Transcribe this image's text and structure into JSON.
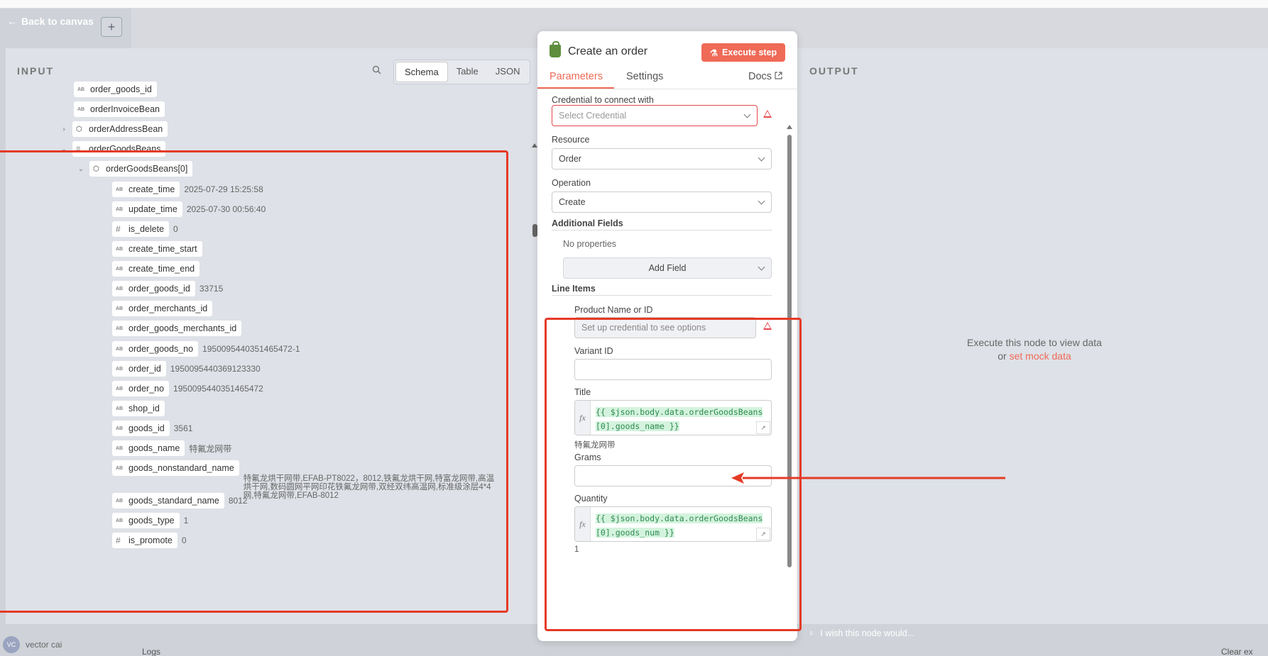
{
  "nav": {
    "back_label": "Back to canvas",
    "plus_label": "+"
  },
  "input_panel": {
    "title": "INPUT",
    "views": [
      "Schema",
      "Table",
      "JSON"
    ],
    "active_view": "Schema",
    "rows": [
      {
        "indent": 0,
        "caret": "",
        "type": "AB",
        "key": "order_goods_id",
        "value": ""
      },
      {
        "indent": 0,
        "caret": "",
        "type": "AB",
        "key": "orderInvoiceBean",
        "value": ""
      },
      {
        "indent": 0,
        "caret": "›",
        "type": "obj",
        "key": "orderAddressBean",
        "value": ""
      },
      {
        "indent": 0,
        "caret": "⌄",
        "type": "arr",
        "key": "orderGoodsBeans",
        "value": ""
      },
      {
        "indent": 1,
        "caret": "⌄",
        "type": "obj",
        "key": "orderGoodsBeans[0]",
        "value": ""
      },
      {
        "indent": 2,
        "caret": "",
        "type": "AB",
        "key": "create_time",
        "value": "2025-07-29 15:25:58"
      },
      {
        "indent": 2,
        "caret": "",
        "type": "AB",
        "key": "update_time",
        "value": "2025-07-30 00:56:40"
      },
      {
        "indent": 2,
        "caret": "",
        "type": "#",
        "key": "is_delete",
        "value": "0"
      },
      {
        "indent": 2,
        "caret": "",
        "type": "AB",
        "key": "create_time_start",
        "value": ""
      },
      {
        "indent": 2,
        "caret": "",
        "type": "AB",
        "key": "create_time_end",
        "value": ""
      },
      {
        "indent": 2,
        "caret": "",
        "type": "AB",
        "key": "order_goods_id",
        "value": "33715"
      },
      {
        "indent": 2,
        "caret": "",
        "type": "AB",
        "key": "order_merchants_id",
        "value": ""
      },
      {
        "indent": 2,
        "caret": "",
        "type": "AB",
        "key": "order_goods_merchants_id",
        "value": ""
      },
      {
        "indent": 2,
        "caret": "",
        "type": "AB",
        "key": "order_goods_no",
        "value": "1950095440351465472-1"
      },
      {
        "indent": 2,
        "caret": "",
        "type": "AB",
        "key": "order_id",
        "value": "1950095440369123330"
      },
      {
        "indent": 2,
        "caret": "",
        "type": "AB",
        "key": "order_no",
        "value": "1950095440351465472"
      },
      {
        "indent": 2,
        "caret": "",
        "type": "AB",
        "key": "shop_id",
        "value": ""
      },
      {
        "indent": 2,
        "caret": "",
        "type": "AB",
        "key": "goods_id",
        "value": "3561"
      },
      {
        "indent": 2,
        "caret": "",
        "type": "AB",
        "key": "goods_name",
        "value": "特氟龙网带"
      },
      {
        "indent": 2,
        "caret": "",
        "type": "AB",
        "key": "goods_nonstandard_name",
        "value": "特氟龙烘干网带,EFAB-PT8022，8012,铁氟龙烘干网,特富龙网带,高温烘干网,数码圆网平网印花铁氟龙网带,双经双纬高温网,标准级涂层4*4网,特氟龙网带,EFAB-8012"
      },
      {
        "indent": 2,
        "caret": "",
        "type": "AB",
        "key": "goods_standard_name",
        "value": "8012"
      },
      {
        "indent": 2,
        "caret": "",
        "type": "AB",
        "key": "goods_type",
        "value": "1"
      },
      {
        "indent": 2,
        "caret": "",
        "type": "#",
        "key": "is_promote",
        "value": "0"
      }
    ]
  },
  "output_panel": {
    "title": "OUTPUT",
    "message_line1": "Execute this node to view data",
    "message_or": "or",
    "mock_link": "set mock data"
  },
  "ndv": {
    "title": "Create an order",
    "execute_label": "Execute step",
    "tabs": [
      "Parameters",
      "Settings"
    ],
    "docs_label": "Docs",
    "credential": {
      "label": "Credential to connect with",
      "placeholder": "Select Credential"
    },
    "resource": {
      "label": "Resource",
      "value": "Order"
    },
    "operation": {
      "label": "Operation",
      "value": "Create"
    },
    "additional_fields": {
      "label": "Additional Fields",
      "empty": "No properties",
      "add_label": "Add Field"
    },
    "line_items": {
      "label": "Line Items",
      "product": {
        "label": "Product Name or ID",
        "placeholder": "Set up credential to see options"
      },
      "variant": {
        "label": "Variant ID",
        "value": ""
      },
      "title": {
        "label": "Title",
        "expr_line1": "{{ $json.body.data.orderGoodsBeans",
        "expr_line2": "[0].goods_name }}",
        "result": "特氟龙网带"
      },
      "grams": {
        "label": "Grams",
        "value": ""
      },
      "quantity": {
        "label": "Quantity",
        "expr_line1": "{{ $json.body.data.orderGoodsBeans",
        "expr_line2": "[0].goods_num }}",
        "result": "1"
      }
    }
  },
  "footer": {
    "user_initials": "VC",
    "user_name": "vector cai",
    "logs_label": "Logs",
    "wish_label": "I wish this node would...",
    "clear_label": "Clear ex"
  },
  "colors": {
    "accent": "#ef6a57",
    "error": "#e5484d",
    "annotation": "#e53a26",
    "expr_green": "#2e8b4f"
  }
}
